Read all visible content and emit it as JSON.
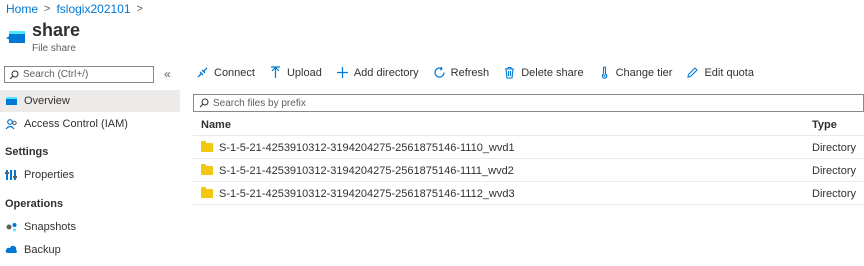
{
  "breadcrumb": {
    "home": "Home",
    "resource": "fslogix202101",
    "sep": ">"
  },
  "header": {
    "title": "share",
    "subtitle": "File share"
  },
  "sidebar": {
    "search_placeholder": "Search (Ctrl+/)",
    "collapse": "«",
    "items": [
      {
        "label": "Overview",
        "icon": "overview-icon",
        "selected": true
      },
      {
        "label": "Access Control (IAM)",
        "icon": "iam-people-icon"
      }
    ],
    "sections": [
      {
        "heading": "Settings",
        "items": [
          {
            "label": "Properties",
            "icon": "properties-icon"
          }
        ]
      },
      {
        "heading": "Operations",
        "items": [
          {
            "label": "Snapshots",
            "icon": "snapshots-icon"
          },
          {
            "label": "Backup",
            "icon": "backup-cloud-icon"
          }
        ]
      }
    ]
  },
  "toolbar": {
    "connect": "Connect",
    "upload": "Upload",
    "add_directory": "Add directory",
    "refresh": "Refresh",
    "delete_share": "Delete share",
    "change_tier": "Change tier",
    "edit_quota": "Edit quota"
  },
  "filter": {
    "placeholder": "Search files by prefix"
  },
  "table": {
    "headers": {
      "name": "Name",
      "type": "Type"
    },
    "rows": [
      {
        "name": "S-1-5-21-4253910312-3194204275-2561875146-1110_wvd1",
        "type": "Directory"
      },
      {
        "name": "S-1-5-21-4253910312-3194204275-2561875146-1111_wvd2",
        "type": "Directory"
      },
      {
        "name": "S-1-5-21-4253910312-3194204275-2561875146-1112_wvd3",
        "type": "Directory"
      }
    ]
  },
  "colors": {
    "accent": "#0078d4",
    "folder": "#f2c811",
    "selected_bg": "#edebe9"
  }
}
